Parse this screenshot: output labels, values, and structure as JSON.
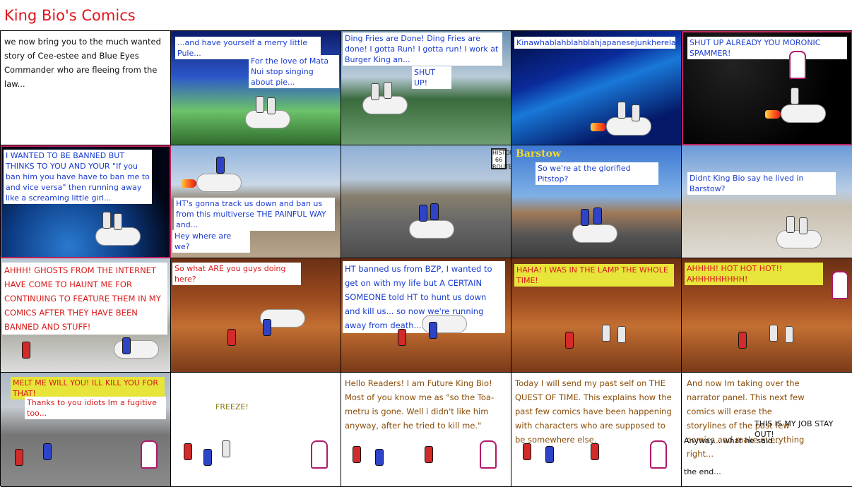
{
  "page": {
    "title": "King Bio's Comics"
  },
  "panels": [
    {
      "id": 1,
      "texts": [
        "we now bring you to the much wanted story of Cee-estee and Blue Eyes Commander who are fleeing from the law..."
      ]
    },
    {
      "id": 2,
      "texts": [
        "...and have yourself a merry little Pule...",
        "For the love of Mata Nui stop singing about pie..."
      ]
    },
    {
      "id": 3,
      "texts": [
        "Ding Fries are Done! Ding Fries are done! I gotta Run! I gotta run! I work at Burger King an...",
        "SHUT UP!"
      ]
    },
    {
      "id": 4,
      "texts": [
        "Kinawhablahblahblahjapanesejunkherelala..."
      ]
    },
    {
      "id": 5,
      "texts": [
        "SHUT UP ALREADY YOU MORONIC SPAMMER!"
      ]
    },
    {
      "id": 6,
      "texts": [
        "I WANTED TO BE BANNED BUT THINKS TO YOU AND YOUR \"If you ban him you have have to ban me to and vice versa\" then running away like a screaming little girl..."
      ]
    },
    {
      "id": 7,
      "texts": [
        "HT's gonna track us down and ban us from this multiverse THE PAINFUL WAY and...",
        "Hey where are we?"
      ]
    },
    {
      "id": 8,
      "texts": [],
      "sign": "HISTORIC 66 ROUTE"
    },
    {
      "id": 9,
      "texts": [
        "So we're at the glorified Pitstop?"
      ],
      "sign": "Barstow"
    },
    {
      "id": 10,
      "texts": [
        "Didnt King Bio say he lived in Barstow?"
      ]
    },
    {
      "id": 11,
      "texts": [
        "AHHH! GHOSTS FROM THE INTERNET HAVE COME TO HAUNT ME FOR CONTINUING TO FEATURE THEM IN MY COMICS AFTER THEY HAVE BEEN BANNED AND STUFF!"
      ]
    },
    {
      "id": 12,
      "texts": [
        "So what ARE you guys doing here?"
      ]
    },
    {
      "id": 13,
      "texts": [
        "HT banned us from BZP, I wanted to get on with my life but A CERTAIN SOMEONE told HT to hunt us down and kill us... so now we're running away from death..."
      ]
    },
    {
      "id": 14,
      "texts": [
        "HAHA! I WAS IN THE LAMP THE WHOLE TIME!"
      ]
    },
    {
      "id": 15,
      "texts": [
        "AHHHH! HOT HOT HOT!! AHHHHHHHHH!"
      ]
    },
    {
      "id": 16,
      "texts": [
        "MELT ME WILL YOU! ILL KILL YOU FOR THAT!",
        "Thanks to you idiots Im a fugitive too..."
      ]
    },
    {
      "id": 17,
      "texts": [
        "FREEZE!"
      ]
    },
    {
      "id": 18,
      "texts": [
        "Hello Readers! I am Future King Bio! Most of you know me as \"so the Toa-metru is gone. Well i didn't like him anyway, after he tried to kill me.\""
      ]
    },
    {
      "id": 19,
      "texts": [
        "Today I will send my past self on THE QUEST OF TIME. This explains how the past few comics have been happening with characters who are supposed to be somewhere else."
      ]
    },
    {
      "id": 20,
      "texts": [
        "And now Im taking over the narrator panel. This next few comics will erase the storylines of the past few comics and make everything right...",
        "THIS IS MY JOB STAY OUT!",
        "Anyway... what he said...",
        "the end..."
      ]
    }
  ],
  "colors": {
    "title": "#e0141c",
    "blue_text": "#1a3cd1",
    "red_text": "#d81b1b",
    "brown_text": "#8a4c07",
    "olive_text": "#8a7a12",
    "yellow_box": "#e7e43a"
  }
}
